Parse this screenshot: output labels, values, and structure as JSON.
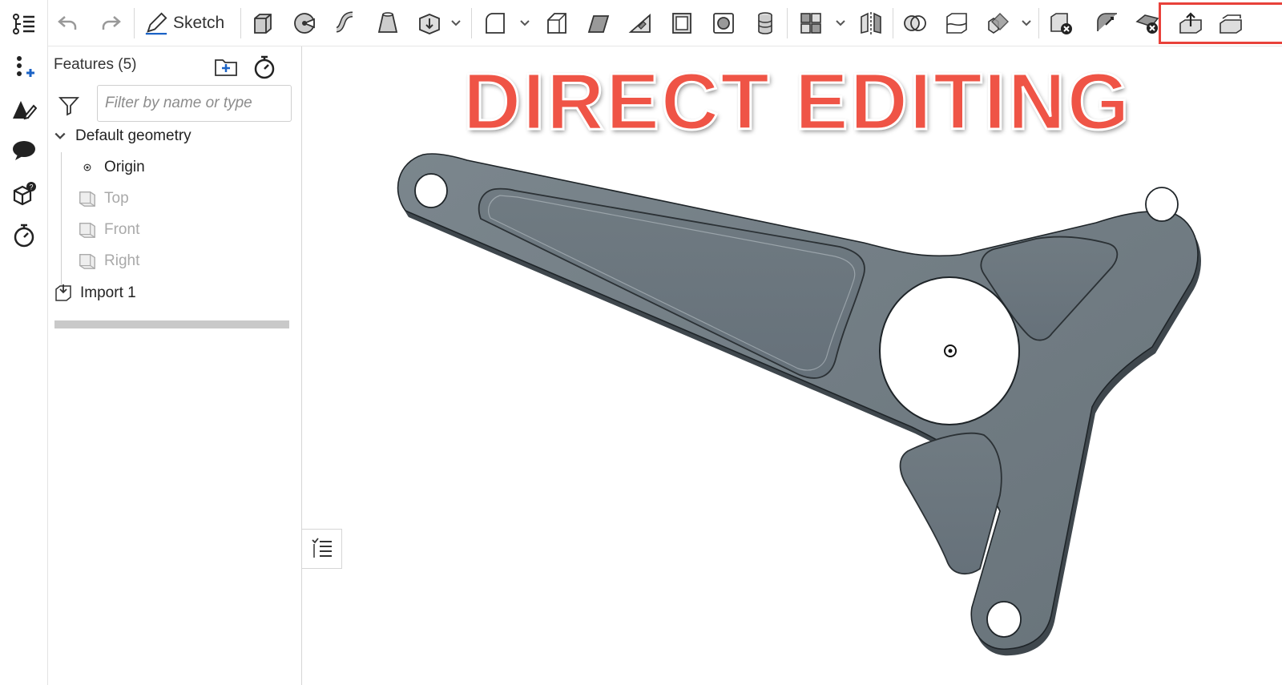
{
  "panel": {
    "title": "Features (5)",
    "filter_placeholder": "Filter by name or type",
    "tree": {
      "default_geometry": "Default geometry",
      "origin": "Origin",
      "top": "Top",
      "front": "Front",
      "right": "Right",
      "import": "Import 1"
    }
  },
  "toolbar": {
    "sketch_label": "Sketch"
  },
  "viewport": {
    "banner": "DIRECT EDITING"
  },
  "colors": {
    "highlight": "#e8413a",
    "banner": "#ef5446",
    "part": "#6f7a82"
  }
}
